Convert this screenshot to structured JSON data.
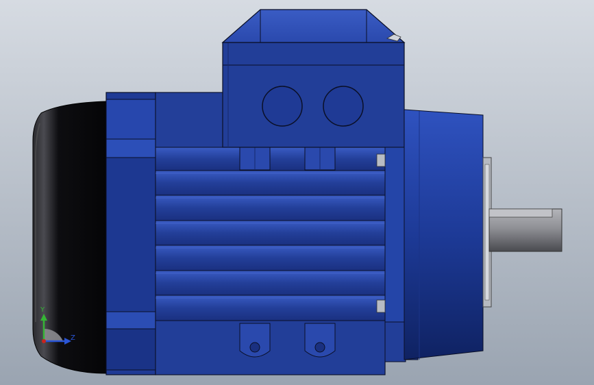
{
  "viewport": {
    "background_top": "#d6dbe2",
    "background_bottom": "#9aa4b1"
  },
  "model": {
    "body_color": "#233f99",
    "body_dark": "#152a6b",
    "body_light": "#3a5cc4",
    "fan_cover_color": "#0b0b0d",
    "shaft_color": "#8f9095",
    "outline_color": "#0a0f26"
  },
  "triad": {
    "y_label": "Y",
    "z_label": "Z",
    "y_color": "#35b535",
    "z_color": "#2a55d6",
    "x_color": "#c8241e"
  }
}
